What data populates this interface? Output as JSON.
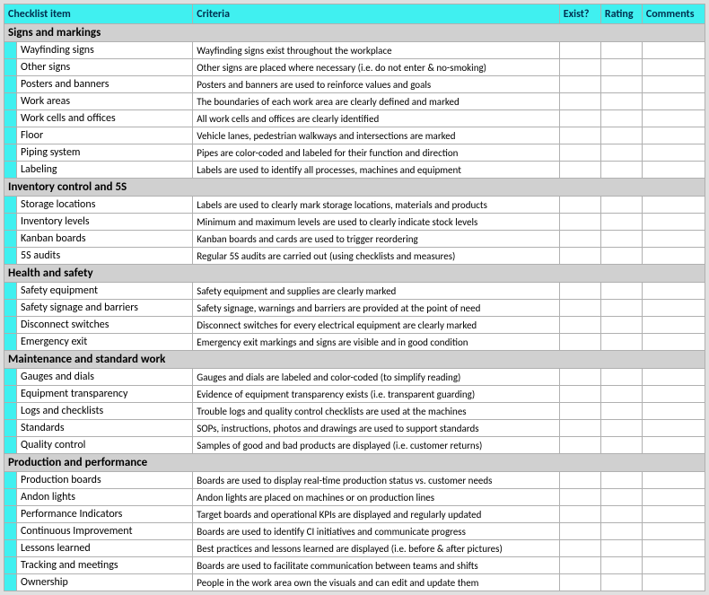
{
  "headers": {
    "checklist_item": "Checklist item",
    "criteria": "Criteria",
    "exist": "Exist?",
    "rating": "Rating",
    "comments": "Comments"
  },
  "sections": [
    {
      "title": "Signs and markings",
      "items": [
        {
          "name": "Wayfinding signs",
          "criteria": "Wayfinding signs exist throughout the workplace"
        },
        {
          "name": "Other signs",
          "criteria": "Other signs are placed where necessary (i.e. do not enter & no-smoking)"
        },
        {
          "name": "Posters and banners",
          "criteria": "Posters and banners are used to reinforce values and goals"
        },
        {
          "name": "Work areas",
          "criteria": "The boundaries of each work area are clearly defined and marked"
        },
        {
          "name": "Work cells and offices",
          "criteria": "All work cells and offices are clearly identified"
        },
        {
          "name": "Floor",
          "criteria": "Vehicle lanes, pedestrian walkways and intersections are marked"
        },
        {
          "name": "Piping system",
          "criteria": "Pipes are color-coded and labeled for their function and direction"
        },
        {
          "name": "Labeling",
          "criteria": "Labels are used to identify all processes, machines and equipment"
        }
      ]
    },
    {
      "title": "Inventory control and 5S",
      "items": [
        {
          "name": "Storage locations",
          "criteria": "Labels are used to clearly mark storage locations, materials and products"
        },
        {
          "name": "Inventory levels",
          "criteria": "Minimum and maximum levels are used to clearly indicate stock levels"
        },
        {
          "name": "Kanban boards",
          "criteria": "Kanban boards and cards are used to trigger reordering"
        },
        {
          "name": "5S audits",
          "criteria": "Regular 5S audits are carried out (using checklists and measures)"
        }
      ]
    },
    {
      "title": "Health and safety",
      "items": [
        {
          "name": "Safety equipment",
          "criteria": "Safety equipment and supplies are clearly marked"
        },
        {
          "name": "Safety signage and barriers",
          "criteria": "Safety signage, warnings and barriers are provided at the point of need"
        },
        {
          "name": "Disconnect switches",
          "criteria": "Disconnect switches for every electrical equipment are clearly marked"
        },
        {
          "name": "Emergency exit",
          "criteria": "Emergency exit markings and signs are visible and in good condition"
        }
      ]
    },
    {
      "title": "Maintenance and standard work",
      "items": [
        {
          "name": "Gauges and dials",
          "criteria": "Gauges and dials are labeled and color-coded (to simplify reading)"
        },
        {
          "name": "Equipment transparency",
          "criteria": "Evidence of equipment transparency exists (i.e. transparent guarding)"
        },
        {
          "name": "Logs and checklists",
          "criteria": "Trouble logs and quality control checklists are used at the machines"
        },
        {
          "name": "Standards",
          "criteria": "SOPs, instructions, photos and drawings are used to support standards"
        },
        {
          "name": "Quality control",
          "criteria": "Samples of good and bad products are displayed (i.e. customer returns)"
        }
      ]
    },
    {
      "title": "Production and performance",
      "items": [
        {
          "name": "Production boards",
          "criteria": "Boards are used to display real-time production status vs. customer needs"
        },
        {
          "name": "Andon lights",
          "criteria": "Andon lights are placed on machines or on production lines"
        },
        {
          "name": "Performance Indicators",
          "criteria": "Target boards and operational KPIs are displayed and regularly updated"
        },
        {
          "name": "Continuous Improvement",
          "criteria": "Boards are used to identify CI initiatives and communicate progress"
        },
        {
          "name": "Lessons learned",
          "criteria": "Best practices and lessons learned are displayed (i.e. before & after pictures)"
        },
        {
          "name": "Tracking and meetings",
          "criteria": "Boards are used to facilitate communication between teams and shifts"
        },
        {
          "name": "Ownership",
          "criteria": "People in the work area own the visuals and can edit and update them"
        }
      ]
    }
  ]
}
